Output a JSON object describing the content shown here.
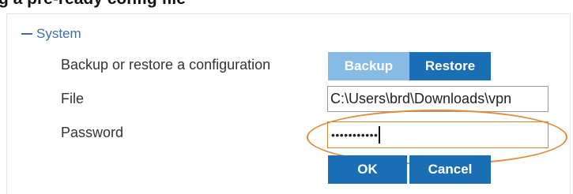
{
  "header": {
    "cropped_heading": "g a pre-ready config file"
  },
  "section": {
    "toggle_symbol": "−",
    "title": "System"
  },
  "form": {
    "backup_restore_label": "Backup or restore a configuration",
    "backup_button": "Backup",
    "restore_button": "Restore",
    "file_label": "File",
    "file_value": "C:\\Users\\brd\\Downloads\\vpn",
    "password_label": "Password",
    "password_masked": "•••••••••••",
    "ok_button": "OK",
    "cancel_button": "Cancel"
  },
  "colors": {
    "accent_blue": "#1a6eb4",
    "inactive_blue": "#88bbe4",
    "section_link": "#3f6ea4",
    "highlight_orange": "#e08a3a"
  }
}
